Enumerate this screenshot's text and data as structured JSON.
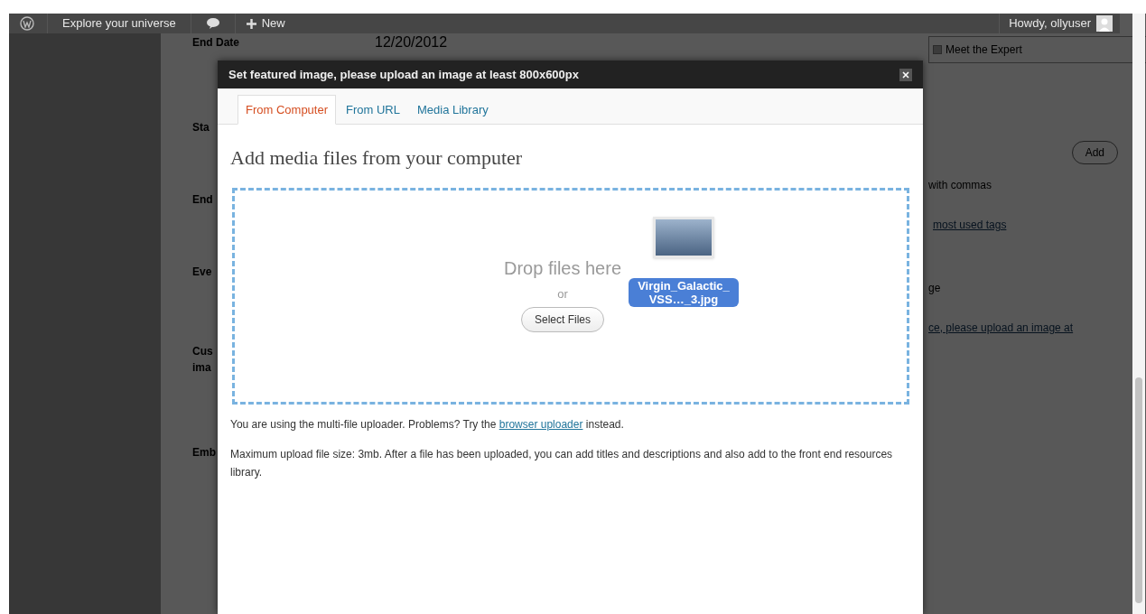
{
  "admin_bar": {
    "site_name": "Explore your universe",
    "new_label": "New",
    "greeting": "Howdy, ollyuser"
  },
  "background_page": {
    "date_label": "End Date",
    "date_value": "12/20/2012",
    "field_labels": [
      "Sta",
      "End",
      "Eve",
      "Cus",
      "ima",
      "Emb"
    ],
    "category": {
      "label": "Meet the Expert",
      "checked": false
    },
    "add_button": "Add",
    "tags_hint": "with commas",
    "tags_link": "most used tags",
    "box_title": "ge",
    "featured_link": "ce, please upload an image at"
  },
  "modal": {
    "title": "Set featured image, please upload an image at least 800x600px",
    "tabs": [
      {
        "label": "From Computer",
        "selected": true
      },
      {
        "label": "From URL",
        "selected": false
      },
      {
        "label": "Media Library",
        "selected": false
      }
    ],
    "heading": "Add media files from your computer",
    "drop_text": "Drop files here",
    "or_text": "or",
    "select_button": "Select Files",
    "dragged_file": "Virgin_Galactic_VSS…_3.jpg",
    "uploader_note": {
      "before": "You are using the multi-file uploader. Problems? Try the",
      "link": "browser uploader",
      "after": "instead."
    },
    "size_note": "Maximum upload file size: 3mb. After a file has been uploaded, you can add titles and descriptions and also add to the front end resources library."
  }
}
